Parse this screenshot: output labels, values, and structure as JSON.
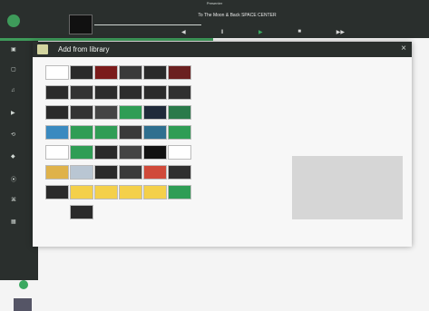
{
  "app": {
    "window_title": "Presenter",
    "brand_name": "",
    "track_title": "To The Moon & Back SPACE CENTER",
    "time_elapsed": "",
    "time_remaining": "",
    "right_label": "",
    "right_value": ""
  },
  "controls": {
    "prev": "◀",
    "pause": "Ⅱ",
    "play": "▶",
    "stop": "■",
    "next": "▶▶"
  },
  "modal": {
    "title": "Add from library",
    "close": "×"
  },
  "tiles": [
    {
      "color": "#ffffff",
      "row": 0,
      "col": 0
    },
    {
      "color": "#2a2a2a",
      "row": 0,
      "col": 1
    },
    {
      "color": "#7b1b1b",
      "row": 0,
      "col": 2
    },
    {
      "color": "#3a3a3a",
      "row": 0,
      "col": 3
    },
    {
      "color": "#2a2a2a",
      "row": 0,
      "col": 4
    },
    {
      "color": "#6b2020",
      "row": 0,
      "col": 5
    },
    {
      "color": "#2b2b2b",
      "row": 1,
      "col": 0
    },
    {
      "color": "#333",
      "row": 1,
      "col": 1
    },
    {
      "color": "#2c2c2c",
      "row": 1,
      "col": 2
    },
    {
      "color": "#2c2c2c",
      "row": 1,
      "col": 3
    },
    {
      "color": "#2b2b2b",
      "row": 1,
      "col": 4
    },
    {
      "color": "#303030",
      "row": 1,
      "col": 5
    },
    {
      "color": "#2a2a2a",
      "row": 2,
      "col": 0
    },
    {
      "color": "#333",
      "row": 2,
      "col": 1
    },
    {
      "color": "#444",
      "row": 2,
      "col": 2
    },
    {
      "color": "#2f9d55",
      "row": 2,
      "col": 3
    },
    {
      "color": "#1f2a3a",
      "row": 2,
      "col": 4
    },
    {
      "color": "#2a7a4a",
      "row": 2,
      "col": 5
    },
    {
      "color": "#3a8ac0",
      "row": 3,
      "col": 0
    },
    {
      "color": "#2f9d55",
      "row": 3,
      "col": 1
    },
    {
      "color": "#2f9d55",
      "row": 3,
      "col": 2
    },
    {
      "color": "#3a3a3a",
      "row": 3,
      "col": 3
    },
    {
      "color": "#2f6f8f",
      "row": 3,
      "col": 4
    },
    {
      "color": "#2f9d55",
      "row": 3,
      "col": 5
    },
    {
      "color": "#ffffff",
      "row": 4,
      "col": 0
    },
    {
      "color": "#2f9d55",
      "row": 4,
      "col": 1
    },
    {
      "color": "#2a2a2a",
      "row": 4,
      "col": 2
    },
    {
      "color": "#444",
      "row": 4,
      "col": 3
    },
    {
      "color": "#111",
      "row": 4,
      "col": 4
    },
    {
      "color": "#ffffff",
      "row": 4,
      "col": 5
    },
    {
      "color": "#dfb24a",
      "row": 5,
      "col": 0
    },
    {
      "color": "#b9c6d3",
      "row": 5,
      "col": 1
    },
    {
      "color": "#2a2a2a",
      "row": 5,
      "col": 2
    },
    {
      "color": "#3a3a3a",
      "row": 5,
      "col": 3
    },
    {
      "color": "#d04a3a",
      "row": 5,
      "col": 4
    },
    {
      "color": "#2f2f2f",
      "row": 5,
      "col": 5
    },
    {
      "color": "#2a2a2a",
      "row": 6,
      "col": 0
    },
    {
      "color": "#f4d04a",
      "row": 6,
      "col": 1
    },
    {
      "color": "#f4d04a",
      "row": 6,
      "col": 2
    },
    {
      "color": "#f4d04a",
      "row": 6,
      "col": 3
    },
    {
      "color": "#f4d04a",
      "row": 6,
      "col": 4
    },
    {
      "color": "#2f9d55",
      "row": 6,
      "col": 5
    },
    {
      "color": "#2a2a2a",
      "row": 7,
      "col": 1
    }
  ]
}
